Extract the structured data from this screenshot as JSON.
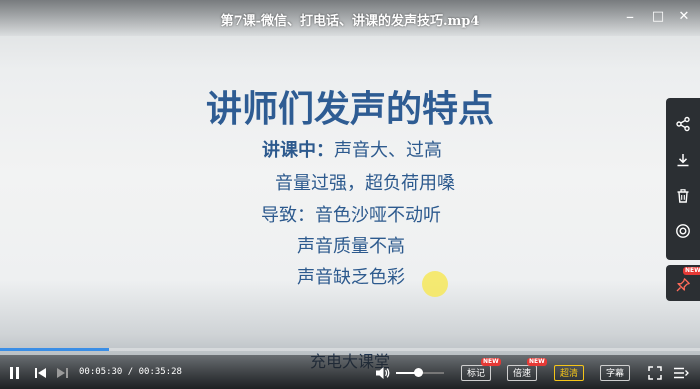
{
  "window": {
    "title": "第7课-微信、打电话、讲课的发声技巧.mp4",
    "minimize_glyph": "–",
    "maximize_glyph": "□",
    "close_glyph": "✕"
  },
  "slide": {
    "heading": "讲师们发声的特点",
    "line1_label": "讲课中：",
    "line1_text": "声音大、过高",
    "line2": "音量过强，超负荷用嗓",
    "line3": "导致：音色沙哑不动听",
    "line4": "声音质量不高",
    "line5": "声音缺乏色彩"
  },
  "watermark": "充电大课堂",
  "side_toolbar": {
    "items": [
      "share-icon",
      "download-icon",
      "delete-icon",
      "target-icon"
    ],
    "pin_icon": "pin-icon",
    "pin_badge": "NEW"
  },
  "playback": {
    "current_time": "00:05:30",
    "separator": "/",
    "total_time": "00:35:28",
    "progress_fraction": 0.155,
    "volume_fraction": 0.45,
    "accent_color": "#3a8ee6"
  },
  "controls": {
    "mark_label": "标记",
    "mark_badge": "NEW",
    "speed_label": "倍速",
    "speed_badge": "NEW",
    "quality_label": "超清",
    "subtitle_label": "字幕"
  }
}
